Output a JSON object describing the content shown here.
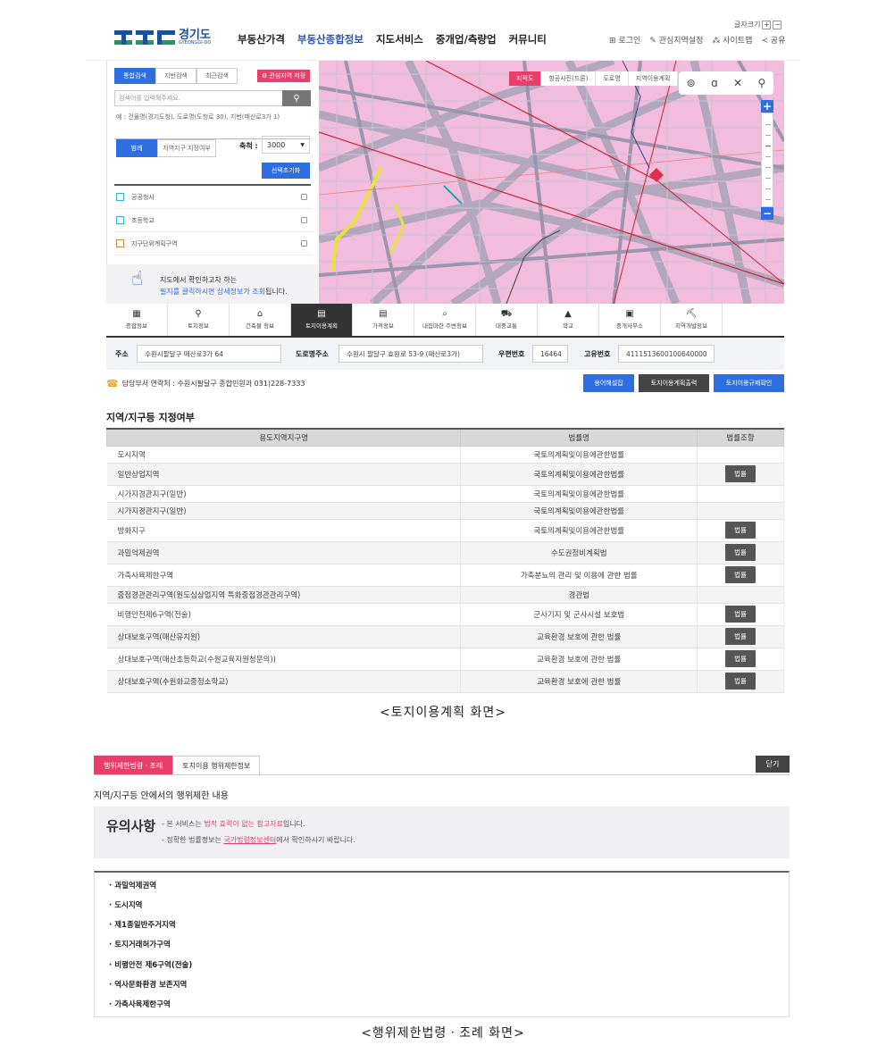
{
  "header": {
    "logo_text": "경기도",
    "logo_sub": "GYEONGGI-DO",
    "nav": [
      "부동산가격",
      "부동산종합정보",
      "지도서비스",
      "중개업/측량업",
      "커뮤니티"
    ],
    "font_size_label": "글자크기",
    "util": [
      "로그인",
      "관심지역설정",
      "사이트맵",
      "공유"
    ]
  },
  "side": {
    "tabs": [
      "통합검색",
      "지번검색",
      "최근검색"
    ],
    "fav_label": "관심지역 저장",
    "search_placeholder": "검색어를 입력해주세요.",
    "example": "예 : 건물명(경기도청), 도로명(도청로 30), 지번(매산로3가 1)",
    "layer_tabs": [
      "범례",
      "지역지구 지정여부"
    ],
    "scale_label": "축척 :",
    "scale_value": "3000",
    "reset_label": "선택초기화",
    "layers": [
      "공공청사",
      "초등학교",
      "지구단위계획구역"
    ],
    "hint_line1": "지도에서 확인하고자 하는",
    "hint_line2a": "필지를 클릭하시면 상세정보가 조회",
    "hint_line2b": "됩니다."
  },
  "map": {
    "tabs": [
      "지적도",
      "항공사진(드론)",
      "도로명",
      "지역이용계획"
    ],
    "tools": [
      "target-icon",
      "a-icon",
      "x-icon",
      "pin-icon"
    ]
  },
  "bottom_tabs": [
    "종합정보",
    "토지정보",
    "건축물 정보",
    "토지이용계획",
    "가격정보",
    "내집마련 주변정보",
    "대중교통",
    "학교",
    "중개사무소",
    "지역개발정보"
  ],
  "address": {
    "addr_label": "주소",
    "addr": "수원시팔달구 매산로3가 64",
    "road_label": "도로명주소",
    "road": "수원시 팔달구 효원로 53-9 (매산로3가)",
    "zip_label": "우편번호",
    "zip": "16464",
    "id_label": "고유번호",
    "id": "4111513600100640000"
  },
  "contact": "담당부서 연락처 : 수원시팔달구 종합민원과 031)228-7333",
  "action_buttons": [
    "용어해설집",
    "토지이용계획출력",
    "토지이용규제확인"
  ],
  "zone_section": {
    "title": "지역/지구등 지정여부",
    "headers": [
      "용도지역지구명",
      "법률명",
      "법률조항"
    ],
    "button_label": "법률",
    "rows": [
      {
        "name": "도시지역",
        "law": "국토의계획및이용에관한법률",
        "btn": false
      },
      {
        "name": "일반상업지역",
        "law": "국토의계획및이용에관한법률",
        "btn": true
      },
      {
        "name": "시가지경관지구(일반)",
        "law": "국토의계획및이용에관한법률",
        "btn": false
      },
      {
        "name": "시가지경관지구(일반)",
        "law": "국토의계획및이용에관한법률",
        "btn": false
      },
      {
        "name": "방화지구",
        "law": "국토의계획및이용에관한법률",
        "btn": true
      },
      {
        "name": "과밀억제권역",
        "law": "수도권정비계획법",
        "btn": true
      },
      {
        "name": "가축사육제한구역",
        "law": "가축분뇨의 관리 및 이용에 관한 법률",
        "btn": true
      },
      {
        "name": "중점경관관리구역(원도심상업지역 특화중점경관관리구역)",
        "law": "경관법",
        "btn": false
      },
      {
        "name": "비행안전제6구역(전술)",
        "law": "군사기지 및 군사시설 보호법",
        "btn": true
      },
      {
        "name": "상대보호구역(매산유치원)",
        "law": "교육환경 보호에 관한 법률",
        "btn": true
      },
      {
        "name": "상대보호구역(매산초등학교(수원교육지원청문의))",
        "law": "교육환경 보호에 관한 법률",
        "btn": true
      },
      {
        "name": "상대보호구역(수원화교중정소학교)",
        "law": "교육환경 보호에 관한 법률",
        "btn": true
      }
    ]
  },
  "caption1": "<토지이용계획 화면>",
  "restrict": {
    "tabs": [
      "행위제한법령ㆍ조례",
      "토지이용 행위제한정보"
    ],
    "close": "닫기",
    "title": "지역/지구등 안에서의 행위제한 내용",
    "notice_title": "유의사항",
    "n1a": "- 본 서비스는 ",
    "n1b": "법적 효력이 없는 참고자료",
    "n1c": "입니다.",
    "n2a": "- 정확한 법률정보는 ",
    "n2b": "국가법령정보센터",
    "n2c": "에서 확인하시기 바랍니다.",
    "items": [
      "과밀억제권역",
      "도시지역",
      "제1종일반주거지역",
      "토지거래허가구역",
      "비행안전 제6구역(전술)",
      "역사문화환경 보존지역",
      "가축사육제한구역"
    ]
  },
  "caption2": "<행위제한법령ㆍ조례 화면>",
  "colors": {
    "accent": "#e83e6c",
    "blue": "#2f6ee0",
    "dark": "#333333"
  }
}
